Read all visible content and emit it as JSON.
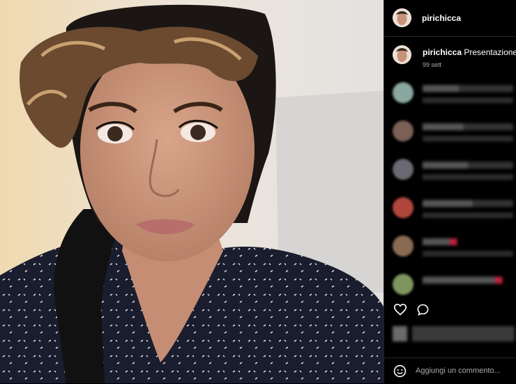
{
  "post": {
    "username": "pirichicca",
    "caption_username": "pirichicca",
    "caption_text": "Presentazione",
    "time_ago": "99 sett"
  },
  "actions": {
    "like_icon": "heart-outline-icon",
    "comment_icon": "comment-bubble-icon"
  },
  "comment_box": {
    "placeholder": "Aggiungi un commento...",
    "emoji_icon": "smiley-icon"
  },
  "colors": {
    "panel_bg": "#000000",
    "text": "#ffffff",
    "secondary_text": "#aaaaaa",
    "heart_red": "#e0245e"
  }
}
